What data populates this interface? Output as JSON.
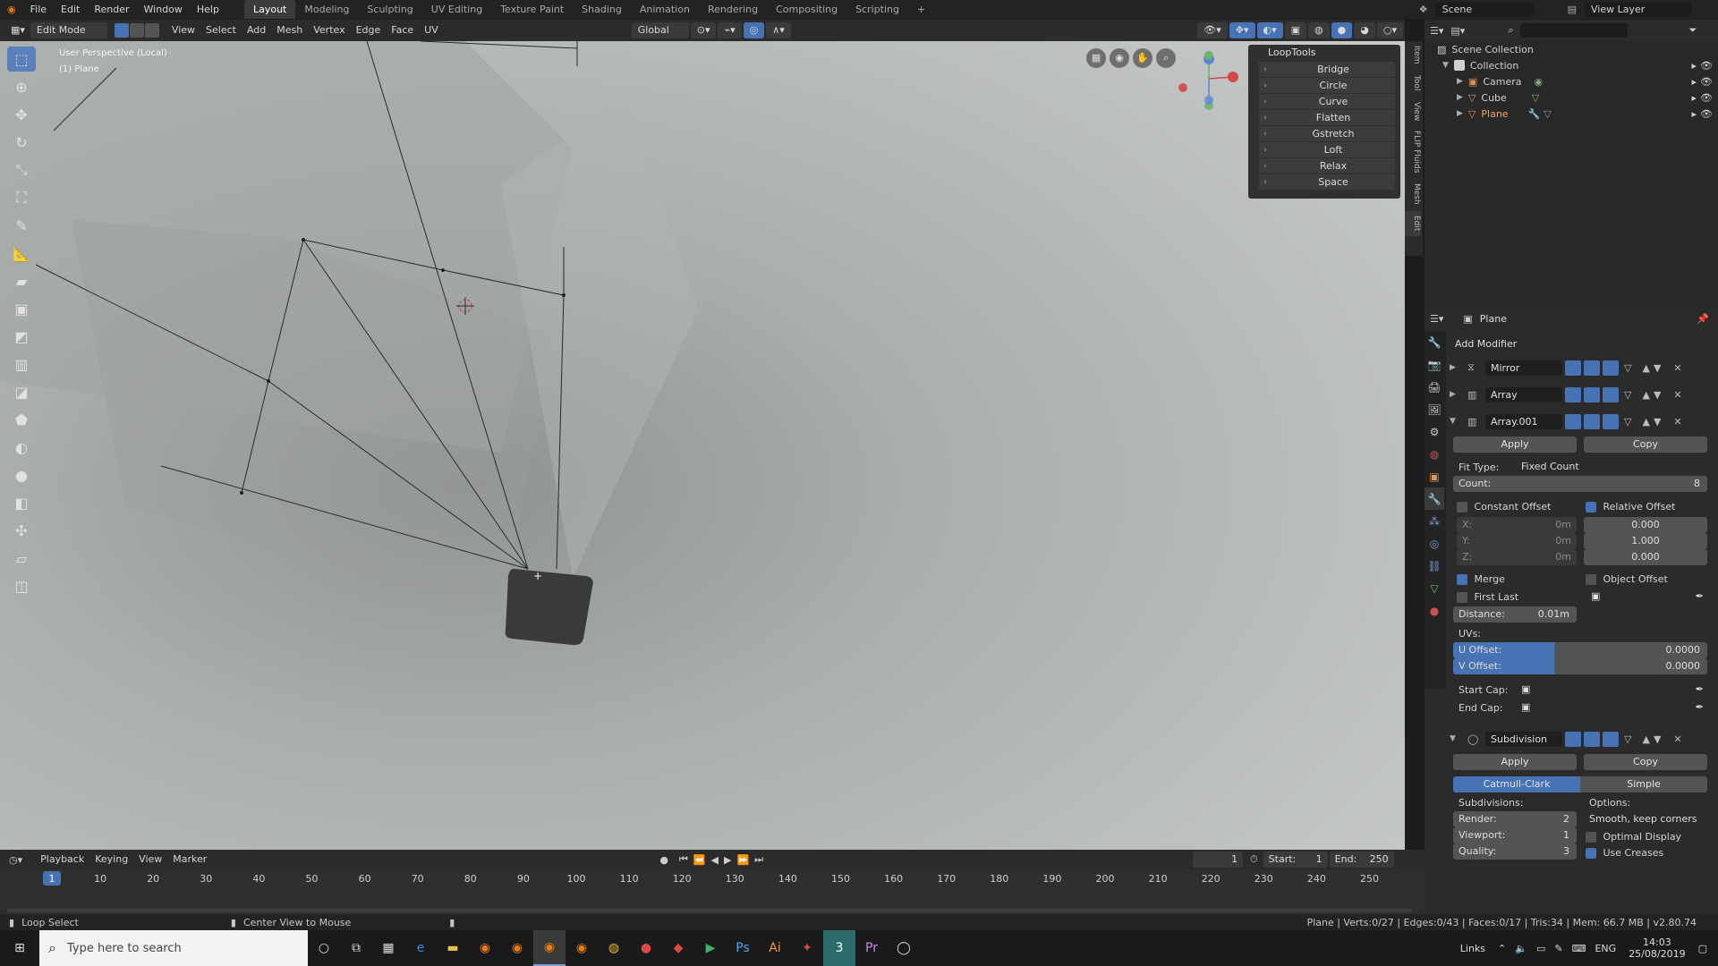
{
  "menu": [
    "File",
    "Edit",
    "Render",
    "Window",
    "Help"
  ],
  "workspaces": [
    "Layout",
    "Modeling",
    "Sculpting",
    "UV Editing",
    "Texture Paint",
    "Shading",
    "Animation",
    "Rendering",
    "Compositing",
    "Scripting"
  ],
  "scene": "Scene",
  "view_layer": "View Layer",
  "viewport_header": {
    "mode": "Edit Mode",
    "menus": [
      "View",
      "Select",
      "Add",
      "Mesh",
      "Vertex",
      "Edge",
      "Face",
      "UV"
    ],
    "orientation": "Global"
  },
  "viewport": {
    "perspective": "User Perspective (Local)",
    "object": "(1) Plane"
  },
  "looptools": {
    "title": "LoopTools",
    "items": [
      "Bridge",
      "Circle",
      "Curve",
      "Flatten",
      "Gstretch",
      "Loft",
      "Relax",
      "Space"
    ]
  },
  "side_tabs": [
    "Item",
    "Tool",
    "View",
    "FLIP Fluids",
    "Mesh",
    "Edit"
  ],
  "outliner": {
    "root": "Scene Collection",
    "collection": "Collection",
    "items": [
      "Camera",
      "Cube",
      "Plane"
    ]
  },
  "properties": {
    "object": "Plane",
    "add_modifier": "Add Modifier",
    "modifiers": [
      "Mirror",
      "Array",
      "Array.001",
      "Subdivision"
    ],
    "apply": "Apply",
    "copy": "Copy",
    "fit_type_label": "Fit Type:",
    "fit_type": "Fixed Count",
    "count_label": "Count:",
    "count": "8",
    "constant_offset": "Constant Offset",
    "relative_offset": "Relative Offset",
    "x_label": "X:",
    "y_label": "Y:",
    "z_label": "Z:",
    "zero_m": "0m",
    "rel_x": "0.000",
    "rel_y": "1.000",
    "rel_z": "0.000",
    "merge": "Merge",
    "object_offset": "Object Offset",
    "first_last": "First Last",
    "distance_label": "Distance:",
    "distance": "0.01m",
    "uvs": "UVs:",
    "u_offset_label": "U Offset:",
    "u_offset": "0.0000",
    "v_offset_label": "V Offset:",
    "v_offset": "0.0000",
    "start_cap": "Start Cap:",
    "end_cap": "End Cap:",
    "catmull": "Catmull-Clark",
    "simple": "Simple",
    "subdivisions": "Subdivisions:",
    "options": "Options:",
    "render_label": "Render:",
    "render": "2",
    "viewport_label": "Viewport:",
    "viewport_val": "1",
    "quality_label": "Quality:",
    "quality": "3",
    "uv_smooth": "Smooth, keep corners",
    "optimal_display": "Optimal Display",
    "use_creases": "Use Creases"
  },
  "timeline": {
    "menus": [
      "Playback",
      "Keying",
      "View",
      "Marker"
    ],
    "current_frame": "1",
    "start_label": "Start:",
    "start": "1",
    "end_label": "End:",
    "end": "250",
    "ticks": [
      "1",
      "10",
      "20",
      "30",
      "40",
      "50",
      "60",
      "70",
      "80",
      "90",
      "100",
      "110",
      "120",
      "130",
      "140",
      "150",
      "160",
      "170",
      "180",
      "190",
      "200",
      "210",
      "220",
      "230",
      "240",
      "250"
    ]
  },
  "status": {
    "left": "Loop Select",
    "middle": "Center View to Mouse",
    "right": "Plane | Verts:0/27 | Edges:0/43 | Faces:0/17 | Tris:34 | Mem: 66.7 MB | v2.80.74"
  },
  "taskbar": {
    "search_placeholder": "Type here to search",
    "links": "Links",
    "lang": "ENG",
    "time": "14:03",
    "date": "25/08/2019"
  },
  "colors": {
    "accent": "#4772b3",
    "viewport_bg": "#b8bcbb",
    "cube": "#3a3a3a"
  }
}
